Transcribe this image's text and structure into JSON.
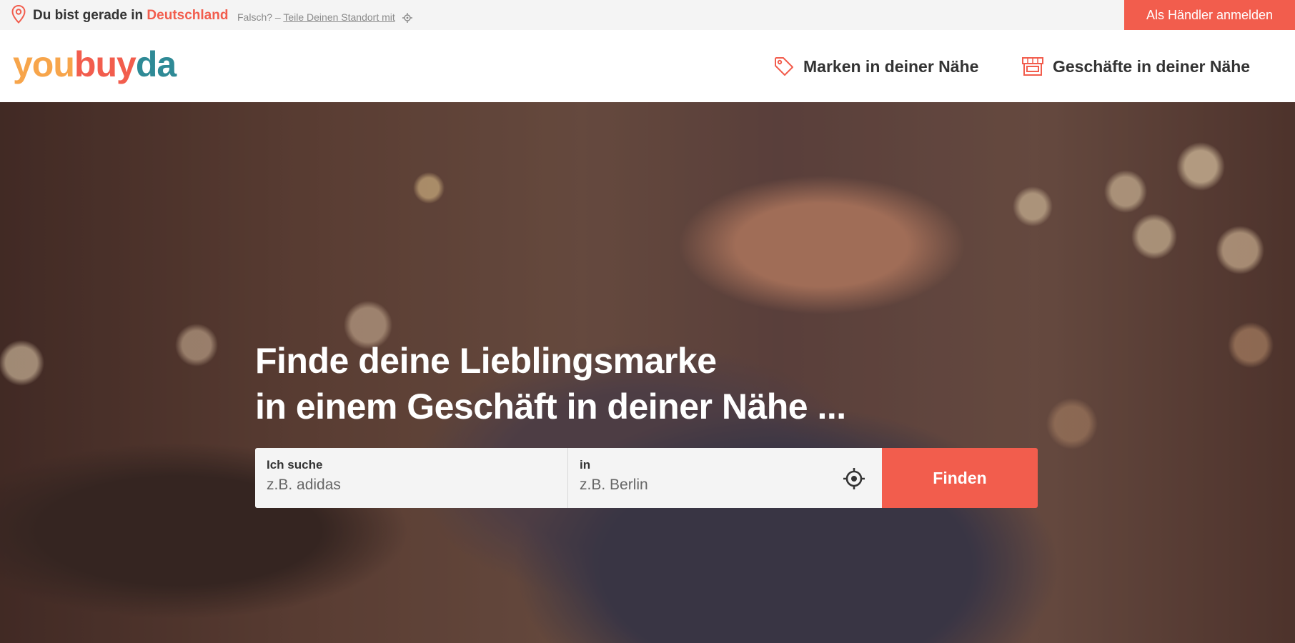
{
  "topbar": {
    "location_prefix": "Du bist gerade in",
    "location_country": "Deutschland",
    "wrong_prefix": "Falsch? –",
    "share_link": "Teile Deinen Standort mit",
    "merchant_login": "Als Händler anmelden"
  },
  "header": {
    "logo": {
      "part1": "you",
      "part2": "buy",
      "part3": "da"
    },
    "nav": [
      {
        "label": "Marken in deiner Nähe",
        "icon": "tag-icon"
      },
      {
        "label": "Geschäfte in deiner Nähe",
        "icon": "store-icon"
      }
    ]
  },
  "hero": {
    "title_line1": "Finde deine Lieblingsmarke",
    "title_line2": "in einem Geschäft in deiner Nähe ..."
  },
  "search": {
    "what_label": "Ich suche",
    "what_placeholder": "z.B. adidas",
    "where_label": "in",
    "where_placeholder": "z.B. Berlin",
    "submit": "Finden"
  },
  "colors": {
    "accent": "#f25d4d",
    "logo_orange": "#f7a54b",
    "logo_teal": "#2f8a96"
  }
}
